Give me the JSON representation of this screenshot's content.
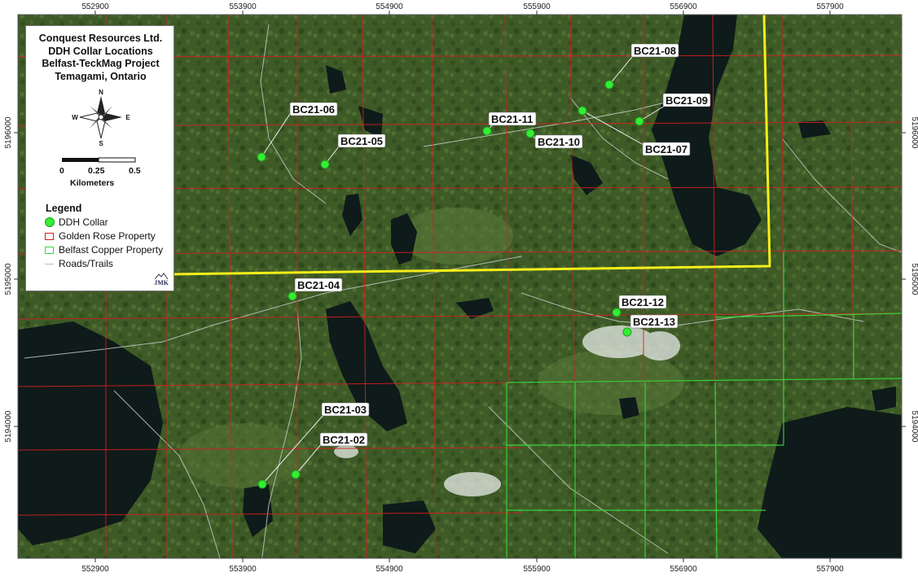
{
  "title": {
    "line1": "Conquest Resources Ltd.",
    "line2": "DDH Collar Locations",
    "line3": "Belfast-TeckMag Project",
    "line4": "Temagami, Ontario"
  },
  "north_arrow": {
    "n": "N",
    "s": "S",
    "e": "E",
    "w": "W"
  },
  "scale_bar": {
    "labels": [
      "0",
      "0.25",
      "0.5"
    ],
    "units": "Kilometers"
  },
  "legend": {
    "heading": "Legend",
    "items": [
      {
        "label": "DDH Collar",
        "color": "#33ee33"
      },
      {
        "label": "Golden Rose Property",
        "color": "#d42020"
      },
      {
        "label": "Belfast Copper Property",
        "color": "#39d639"
      },
      {
        "label": "Roads/Trails",
        "color": "#bbbbbb"
      }
    ]
  },
  "logo_text": "JMK",
  "axes": {
    "easting_ticks": [
      "552900",
      "553900",
      "554900",
      "555900",
      "556900",
      "557900"
    ],
    "northing_ticks": [
      "5196000",
      "5195000",
      "5194000"
    ]
  },
  "collars": [
    {
      "id": "BC21-02",
      "label": "BC21-02"
    },
    {
      "id": "BC21-03",
      "label": "BC21-03"
    },
    {
      "id": "BC21-04",
      "label": "BC21-04"
    },
    {
      "id": "BC21-05",
      "label": "BC21-05"
    },
    {
      "id": "BC21-06",
      "label": "BC21-06"
    },
    {
      "id": "BC21-07",
      "label": "BC21-07"
    },
    {
      "id": "BC21-08",
      "label": "BC21-08"
    },
    {
      "id": "BC21-09",
      "label": "BC21-09"
    },
    {
      "id": "BC21-10",
      "label": "BC21-10"
    },
    {
      "id": "BC21-11",
      "label": "BC21-11"
    },
    {
      "id": "BC21-12",
      "label": "BC21-12"
    },
    {
      "id": "BC21-13",
      "label": "BC21-13"
    }
  ],
  "colors": {
    "imagery_base": "#3d5a26",
    "water": "#0f1a1a",
    "golden_rose": "#d42020",
    "belfast": "#39d639",
    "project_boundary": "#f5ee1a",
    "collar": "#33ee33"
  }
}
